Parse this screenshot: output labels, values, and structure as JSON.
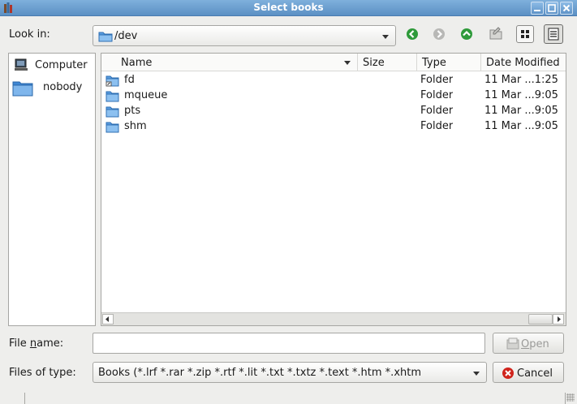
{
  "window": {
    "title": "Select books",
    "icon": "books-app-icon",
    "controls": [
      "minimize-icon",
      "maximize-icon",
      "close-icon"
    ]
  },
  "look_in": {
    "label": "Look in:",
    "value": "/dev",
    "icon": "folder-icon"
  },
  "toolbar": {
    "buttons": [
      "back-icon",
      "forward-icon",
      "parent-directory-icon",
      "new-folder-icon",
      "icon-view-icon",
      "detail-view-icon"
    ]
  },
  "places": [
    {
      "label": "Computer",
      "icon": "computer-icon"
    },
    {
      "label": "nobody",
      "icon": "folder-icon"
    }
  ],
  "columns": {
    "name": "Name",
    "size": "Size",
    "type": "Type",
    "date": "Date Modified"
  },
  "files": [
    {
      "name": "fd",
      "size": "",
      "type": "Folder",
      "date": "11 Mar ...1:25",
      "icon": "folder-link-icon"
    },
    {
      "name": "mqueue",
      "size": "",
      "type": "Folder",
      "date": "11 Mar ...9:05",
      "icon": "folder-icon"
    },
    {
      "name": "pts",
      "size": "",
      "type": "Folder",
      "date": "11 Mar ...9:05",
      "icon": "folder-icon"
    },
    {
      "name": "shm",
      "size": "",
      "type": "Folder",
      "date": "11 Mar ...9:05",
      "icon": "folder-icon"
    }
  ],
  "file_name": {
    "label_prefix": "File ",
    "label_underlined": "n",
    "label_suffix": "ame:",
    "value": ""
  },
  "open_button": {
    "label_underlined": "O",
    "label_rest": "pen",
    "icon": "open-icon",
    "enabled": false
  },
  "files_of_type": {
    "label": "Files of type:",
    "value": "Books (*.lrf *.rar *.zip *.rtf *.lit *.txt *.txtz *.text *.htm *.xhtm"
  },
  "cancel_button": {
    "label": "Cancel",
    "icon": "cancel-icon"
  },
  "colors": {
    "titlebar": "#5b90c4",
    "folder": "#4a8fd6",
    "toolbar_green": "#2e9a3a",
    "cancel_red": "#d0241c"
  }
}
